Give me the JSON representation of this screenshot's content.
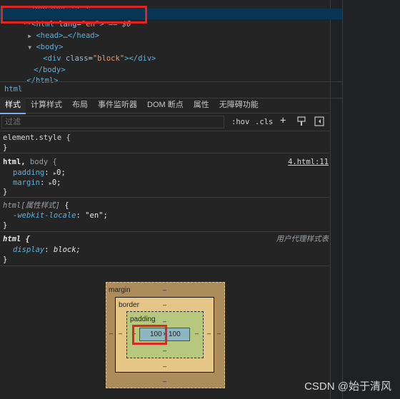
{
  "dom_tree": {
    "doctype": "<!DOCTYPE html>",
    "html_open_tag": "html",
    "html_attr": "lang",
    "html_attr_value": "\"en\"",
    "selected_suffix": "== $0",
    "head_collapsed": "<head>…</head>",
    "body_tag": "body",
    "div_tag": "div",
    "div_attr": "class",
    "div_attr_value": "\"block\"",
    "body_close": "</body>",
    "html_close": "</html>"
  },
  "breadcrumb": "html",
  "tabs": [
    "样式",
    "计算样式",
    "布局",
    "事件监听器",
    "DOM 断点",
    "属性",
    "无障碍功能"
  ],
  "filter": {
    "placeholder": "过滤",
    "hov": ":hov",
    "cls": ".cls",
    "plus": "+"
  },
  "rules": {
    "element_style": {
      "selector": "element.style {",
      "close": "}"
    },
    "html_body": {
      "selector_main": "html,",
      "selector_dim": " body {",
      "source": "4.html:11",
      "props": [
        {
          "name": "padding",
          "value": "0;"
        },
        {
          "name": "margin",
          "value": "0;"
        }
      ],
      "close": "}"
    },
    "html_attr_style": {
      "selector_main": "html",
      "selector_dim": "[属性样式]",
      "brace": " {",
      "props": [
        {
          "name": "-webkit-locale",
          "value": "\"en\";"
        }
      ],
      "close": "}"
    },
    "html_ua": {
      "selector": "html {",
      "source": "用户代理样式表",
      "props": [
        {
          "name": "display",
          "value": "block;"
        }
      ],
      "close": "}"
    }
  },
  "box_model": {
    "margin_label": "margin",
    "border_label": "border",
    "padding_label": "padding",
    "dash": "–",
    "content_width": "100",
    "content_sep": "×",
    "content_height": "100"
  },
  "watermark": "CSDN @始于清风",
  "colors": {
    "highlight": "#e02424",
    "selected_row": "#073655",
    "accent_tab": "#7cacf8"
  }
}
